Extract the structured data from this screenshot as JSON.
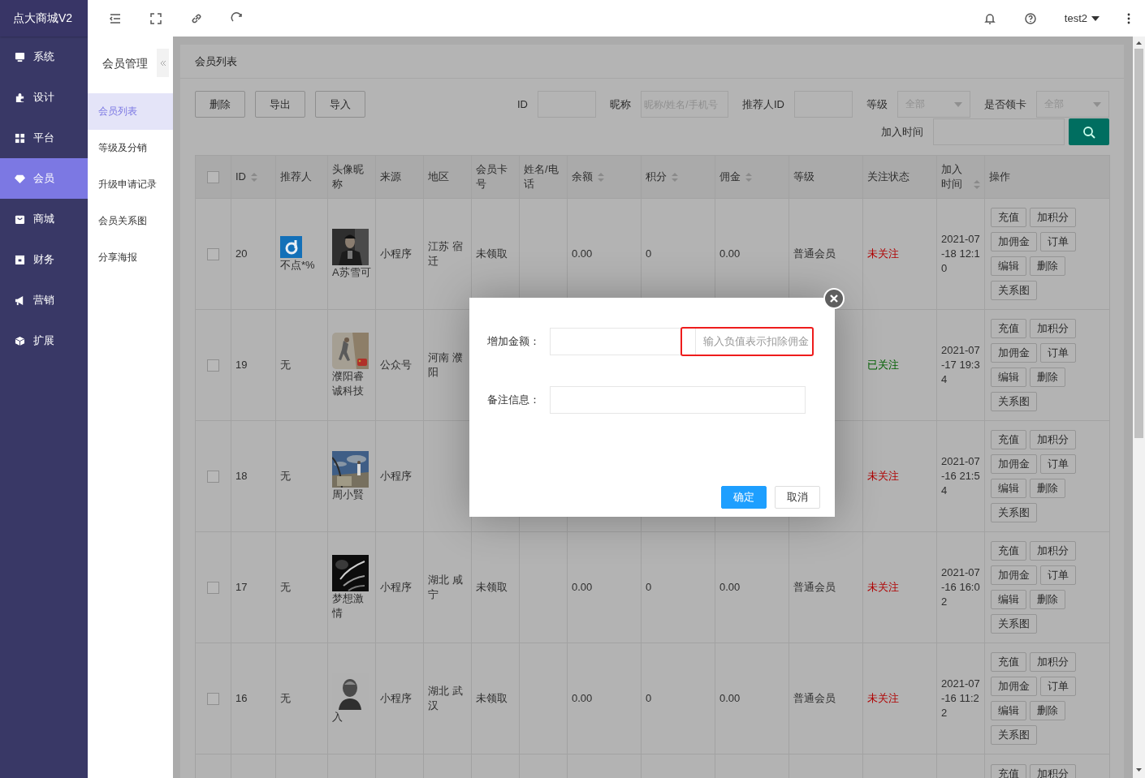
{
  "app": {
    "logo": "点大商城V2"
  },
  "sidebar": {
    "items": [
      {
        "label": "系统",
        "selected": false
      },
      {
        "label": "设计",
        "selected": false
      },
      {
        "label": "平台",
        "selected": false
      },
      {
        "label": "会员",
        "selected": true
      },
      {
        "label": "商城",
        "selected": false
      },
      {
        "label": "财务",
        "selected": false
      },
      {
        "label": "营销",
        "selected": false
      },
      {
        "label": "扩展",
        "selected": false
      }
    ]
  },
  "header": {
    "user": "test2"
  },
  "submenu": {
    "title": "会员管理",
    "items": [
      {
        "label": "会员列表",
        "selected": true
      },
      {
        "label": "等级及分销",
        "selected": false
      },
      {
        "label": "升级申请记录",
        "selected": false
      },
      {
        "label": "会员关系图",
        "selected": false
      },
      {
        "label": "分享海报",
        "selected": false
      }
    ]
  },
  "page": {
    "title": "会员列表"
  },
  "toolbar": {
    "buttons": [
      "删除",
      "导出",
      "导入"
    ]
  },
  "filters": [
    {
      "label": "ID",
      "kind": "text"
    },
    {
      "label": "昵称",
      "kind": "text",
      "placeholder": "昵称/姓名/手机号"
    },
    {
      "label": "推荐人ID",
      "kind": "text"
    },
    {
      "label": "等级",
      "kind": "select",
      "value": "全部"
    },
    {
      "label": "是否领卡",
      "kind": "select",
      "value": "全部"
    },
    {
      "label": "加入时间",
      "kind": "date"
    }
  ],
  "table": {
    "columns": [
      {
        "kind": "checkbox",
        "checked": false
      },
      {
        "label": "ID",
        "sortable": true
      },
      {
        "label": "推荐人",
        "sortable": false
      },
      {
        "label": "头像昵称",
        "sortable": false
      },
      {
        "label": "来源",
        "sortable": false
      },
      {
        "label": "地区",
        "sortable": false
      },
      {
        "label": "会员卡号",
        "sortable": false
      },
      {
        "label": "姓名/电话",
        "sortable": false
      },
      {
        "label": "余额",
        "sortable": true
      },
      {
        "label": "积分",
        "sortable": true
      },
      {
        "label": "佣金",
        "sortable": true
      },
      {
        "label": "等级",
        "sortable": false
      },
      {
        "label": "关注状态",
        "sortable": false
      },
      {
        "label": "加入时间",
        "sortable": true
      },
      {
        "label": "操作",
        "sortable": false
      }
    ],
    "rows": [
      {
        "checked": false,
        "id": "20",
        "referrer": "不点*%",
        "referrer_avatar": true,
        "nickname": "A苏雪可",
        "source": "小程序",
        "region": "江苏 宿迁",
        "card": "未领取",
        "balance": "0.00",
        "points": "0",
        "commission": "0.00",
        "level": "普通会员",
        "follow": {
          "label": "未关注",
          "followed": false
        },
        "joined": "2021-07-18 12:10",
        "actions": [
          "充值",
          "加积分",
          "加佣金",
          "订单",
          "编辑",
          "删除",
          "关系图"
        ]
      },
      {
        "checked": false,
        "id": "19",
        "referrer": "无",
        "referrer_avatar": false,
        "nickname": "濮阳睿诚科技",
        "source": "公众号",
        "region": "河南 濮阳",
        "follow": {
          "label": "已关注",
          "followed": true
        },
        "joined": "2021-07-17 19:34",
        "actions": [
          "充值",
          "加积分",
          "加佣金",
          "订单",
          "编辑",
          "删除",
          "关系图"
        ]
      },
      {
        "checked": false,
        "id": "18",
        "referrer": "无",
        "referrer_avatar": false,
        "nickname": "周小賢",
        "source": "小程序",
        "follow": {
          "label": "未关注",
          "followed": false
        },
        "joined": "2021-07-16 21:54",
        "actions": [
          "充值",
          "加积分",
          "加佣金",
          "订单",
          "编辑",
          "删除",
          "关系图"
        ]
      },
      {
        "checked": false,
        "id": "17",
        "referrer": "无",
        "referrer_avatar": false,
        "nickname": "梦想激情",
        "source": "小程序",
        "region": "湖北 咸宁",
        "card": "未领取",
        "balance": "0.00",
        "points": "0",
        "commission": "0.00",
        "level": "普通会员",
        "follow": {
          "label": "未关注",
          "followed": false
        },
        "joined": "2021-07-16 16:02",
        "actions": [
          "充值",
          "加积分",
          "加佣金",
          "订单",
          "编辑",
          "删除",
          "关系图"
        ]
      },
      {
        "checked": false,
        "id": "16",
        "referrer": "无",
        "referrer_avatar": false,
        "nickname": "入",
        "source": "小程序",
        "region": "湖北 武汉",
        "card": "未领取",
        "balance": "0.00",
        "points": "0",
        "commission": "0.00",
        "level": "普通会员",
        "follow": {
          "label": "未关注",
          "followed": false
        },
        "joined": "2021-07-16 11:22",
        "actions": [
          "充值",
          "加积分",
          "加佣金",
          "订单",
          "编辑",
          "删除",
          "关系图"
        ]
      },
      {
        "actions": [
          "充值",
          "加积分"
        ]
      }
    ]
  },
  "dialog": {
    "fields": [
      {
        "label": "增加金额：",
        "hint": "输入负值表示扣除佣金",
        "highlighted": true
      },
      {
        "label": "备注信息："
      }
    ],
    "buttons": [
      {
        "label": "确定",
        "primary": true
      },
      {
        "label": "取消",
        "primary": false
      }
    ]
  }
}
